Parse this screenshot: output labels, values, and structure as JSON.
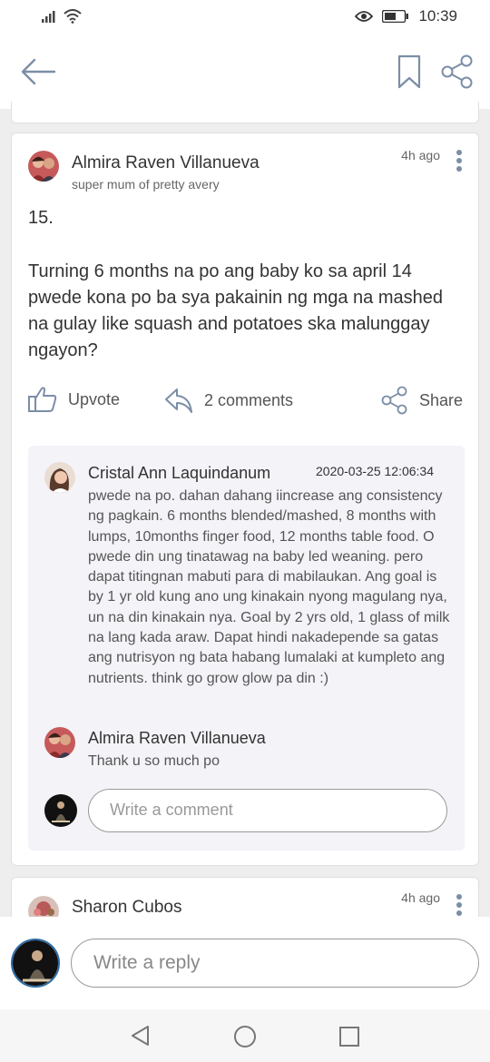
{
  "status": {
    "time": "10:39"
  },
  "post": {
    "author": "Almira Raven Villanueva",
    "subtitle": "super mum of pretty avery",
    "time_ago": "4h ago",
    "number": "15.",
    "body": "Turning 6 months na po ang baby ko sa april 14 pwede kona po ba sya pakainin ng mga na mashed na gulay like squash and potatoes ska malunggay ngayon?",
    "actions": {
      "upvote": "Upvote",
      "comments": "2 comments",
      "share": "Share"
    }
  },
  "comments": [
    {
      "author": "Cristal Ann Laquindanum",
      "date": "2020-03-25 12:06:34",
      "text": "pwede na po. dahan dahang iincrease ang consistency ng pagkain. 6 months blended/mashed, 8 months with lumps, 10months finger food, 12 months table food. O pwede din ung tinatawag na baby led weaning. pero dapat titingnan mabuti para di mabilaukan. Ang goal is by 1 yr old kung ano ung kinakain nyong magulang nya, un na din kinakain nya. Goal by 2 yrs old, 1 glass of milk na lang kada araw. Dapat hindi nakadepende sa gatas ang nutrisyon ng bata habang lumalaki at kumpleto ang nutrients. think go grow glow pa din :)"
    },
    {
      "author": "Almira Raven Villanueva",
      "text": "Thank u so much po"
    }
  ],
  "comment_input": {
    "placeholder": "Write a comment"
  },
  "next_post": {
    "author": "Sharon Cubos",
    "time_ago": "4h ago"
  },
  "reply": {
    "placeholder": "Write a reply"
  },
  "colors": {
    "accent": "#7b8ea6",
    "comments_bg": "#f4f3f8"
  }
}
